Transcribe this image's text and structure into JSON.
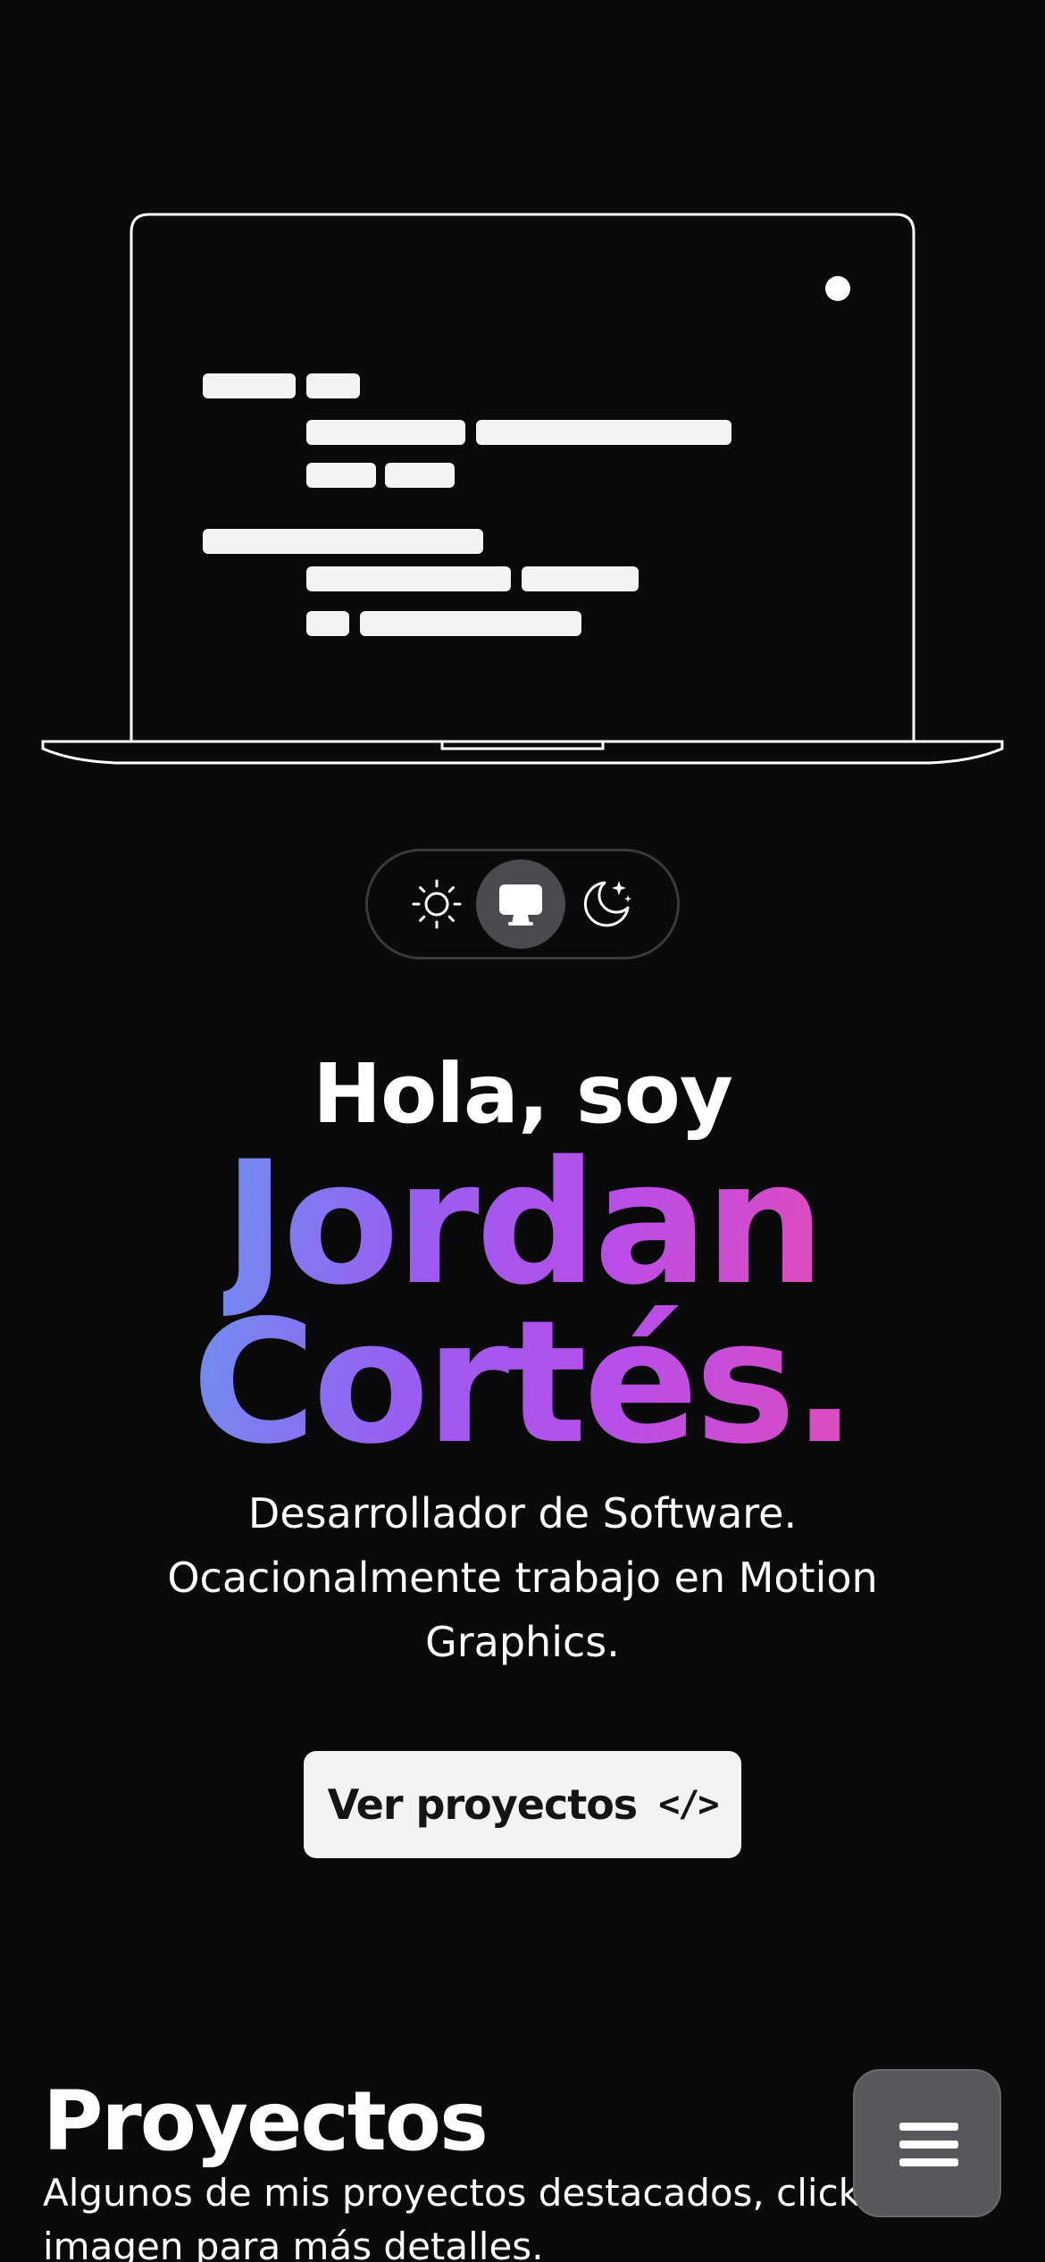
{
  "hero": {
    "greeting": "Hola, soy",
    "first_name": "Jordan",
    "last_name": "Cortés.",
    "tagline_line1": "Desarrollador de Software.",
    "tagline_line2": "Ocacionalmente trabajo en Motion",
    "tagline_line3": "Graphics.",
    "cta_label": "Ver proyectos",
    "cta_icon": "</>"
  },
  "theme_switch": {
    "options": [
      "light",
      "system",
      "dark"
    ],
    "selected": "system"
  },
  "projects": {
    "title": "Proyectos",
    "description_line1": "Algunos de mis proyectos destacados, click",
    "description_line2": "imagen para más detalles."
  },
  "colors": {
    "background": "#0a0a0c",
    "gradient_start": "#6f8ff0",
    "gradient_mid": "#9b5cf0",
    "gradient_end": "#e04bbc",
    "button_bg": "#f3f3f3",
    "fab_bg": "#58585c"
  },
  "icons": {
    "light": "sun-icon",
    "system": "monitor-icon",
    "dark": "moon-stars-icon",
    "menu": "hamburger-icon"
  }
}
